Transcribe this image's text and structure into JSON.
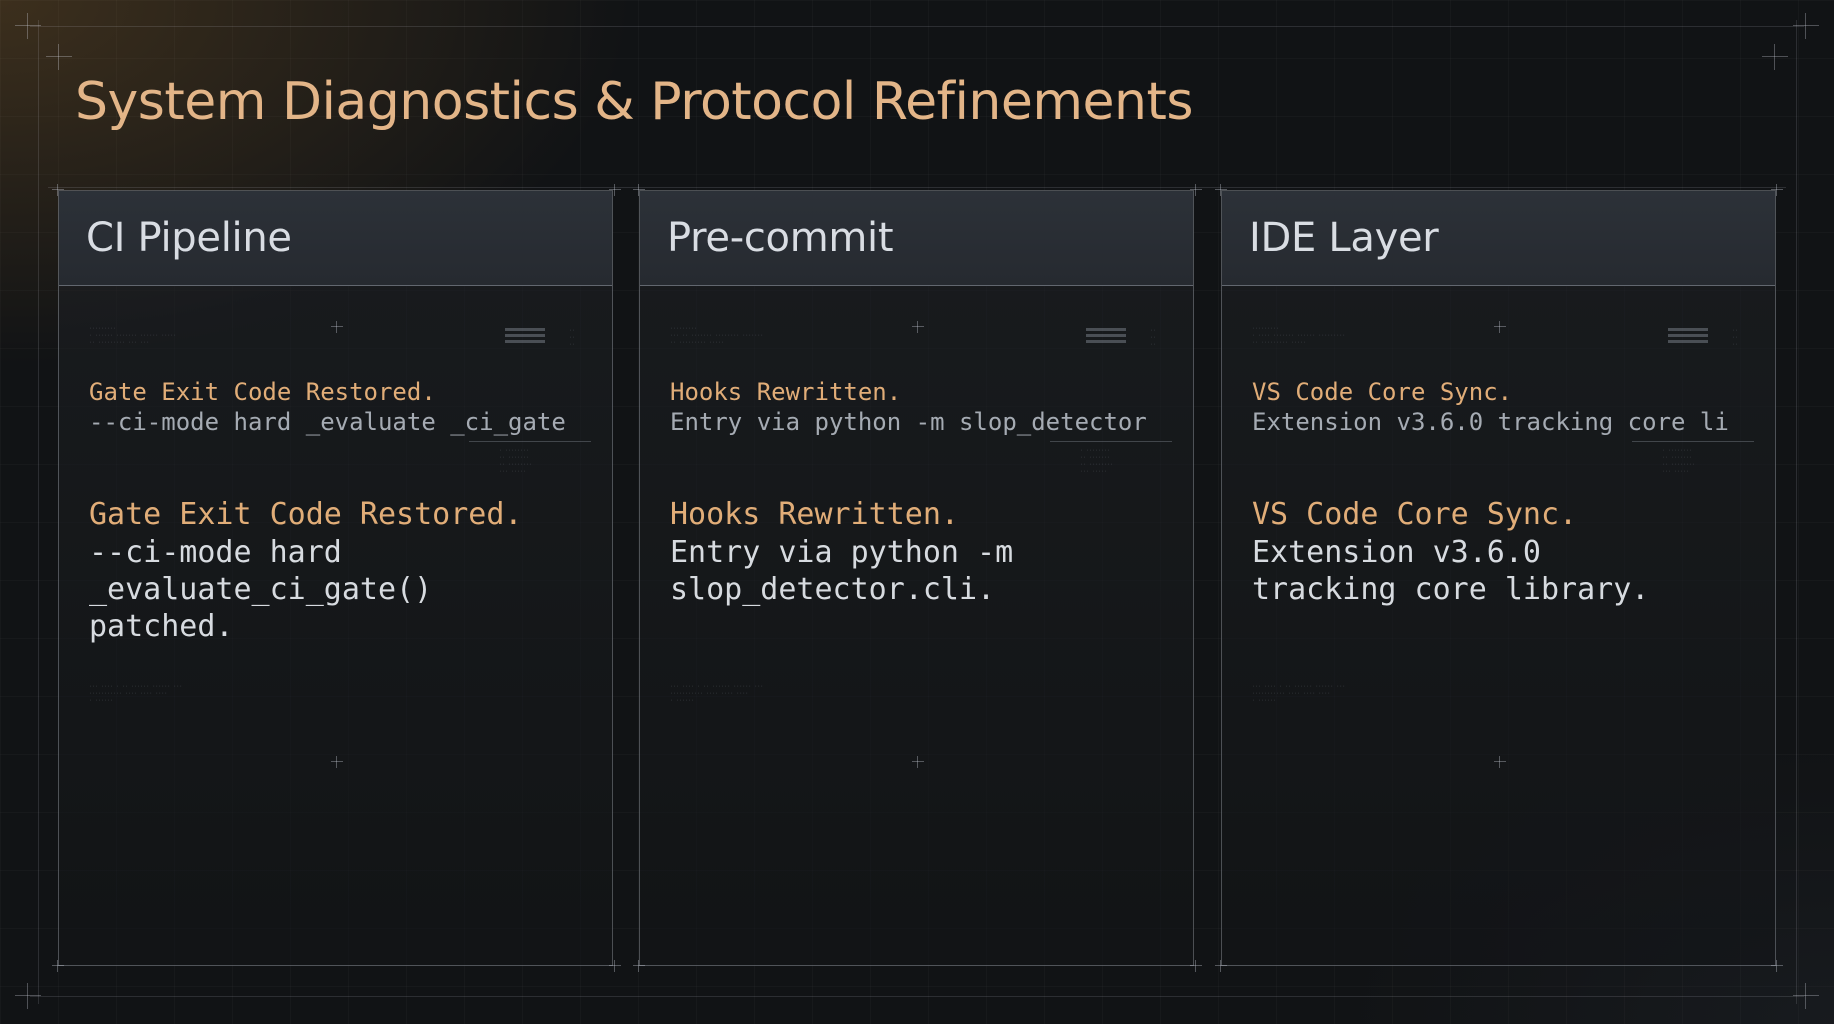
{
  "page": {
    "title": "System Diagnostics & Protocol Refinements"
  },
  "colors": {
    "accent": "#e1ad78",
    "title": "#e3b588",
    "header_bg": "#2c3138",
    "body_text": "#d7dbe0",
    "muted_text": "#a5abb3"
  },
  "panels": [
    {
      "title": "CI Pipeline",
      "summary_title": "Gate Exit Code Restored.",
      "summary_sub": "--ci-mode hard _evaluate _ci_gate",
      "detail_title": "Gate Exit Code Restored.",
      "detail_lines": [
        "--ci-mode hard",
        "_evaluate_ci_gate()",
        "patched."
      ]
    },
    {
      "title": "Pre-commit",
      "summary_title": "Hooks Rewritten.",
      "summary_sub": "Entry via python -m slop_detector",
      "detail_title": "Hooks Rewritten.",
      "detail_lines": [
        "Entry via python -m",
        "slop_detector.cli."
      ]
    },
    {
      "title": "IDE Layer",
      "summary_title": "VS Code Core Sync.",
      "summary_sub": "Extension v3.6.0 tracking core li",
      "detail_title": "VS Code Core Sync.",
      "detail_lines": [
        "Extension v3.6.0",
        "tracking core library."
      ]
    }
  ]
}
